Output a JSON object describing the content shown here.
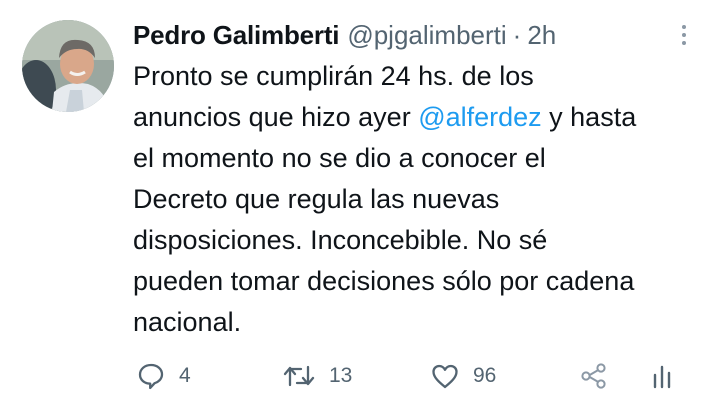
{
  "user": {
    "display_name": "Pedro Galimberti",
    "handle": "@pjgalimberti",
    "separator": "·",
    "time": "2h"
  },
  "tweet": {
    "lines": [
      [
        "Pronto se cumplirán 24 hs. de los"
      ],
      [
        "anuncios que hizo ayer ",
        "@alferdez",
        " y hasta"
      ],
      [
        "el momento no se dio a conocer el"
      ],
      [
        "Decreto que regula las nuevas"
      ],
      [
        "disposiciones. Inconcebible. No sé"
      ],
      [
        "pueden tomar decisiones sólo por cadena"
      ],
      [
        "nacional."
      ]
    ]
  },
  "actions": {
    "reply_count": "4",
    "retweet_count": "13",
    "like_count": "96"
  },
  "icons": {
    "avatar": "profile-photo",
    "more": "vertical-ellipsis-icon",
    "reply": "speech-bubble-icon",
    "retweet": "retweet-arrows-icon",
    "like": "heart-outline-icon",
    "share": "share-icon",
    "analytics": "bar-chart-icon"
  },
  "colors": {
    "text": "#0f1419",
    "secondary": "#536471",
    "mention": "#1d9bf0",
    "background": "#ffffff"
  }
}
